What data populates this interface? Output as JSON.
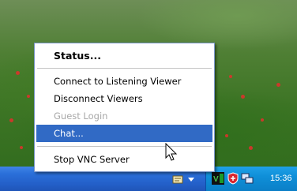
{
  "context_menu": {
    "items": [
      {
        "label": "Status...",
        "style": "bold"
      },
      {
        "label": "Connect to Listening Viewer",
        "style": "normal"
      },
      {
        "label": "Disconnect Viewers",
        "style": "normal"
      },
      {
        "label": "Guest Login",
        "style": "disabled"
      },
      {
        "label": "Chat...",
        "style": "highlighted"
      },
      {
        "label": "Stop VNC Server",
        "style": "normal"
      }
    ]
  },
  "taskbar": {
    "clock": "15:36",
    "tray_icons": [
      "notification-icon",
      "chevron-down-icon",
      "vnc-icon",
      "security-shield-icon",
      "network-icon"
    ]
  },
  "colors": {
    "highlight": "#316ac5",
    "taskbar": "#2460c9",
    "tray": "#0f8fd8"
  }
}
